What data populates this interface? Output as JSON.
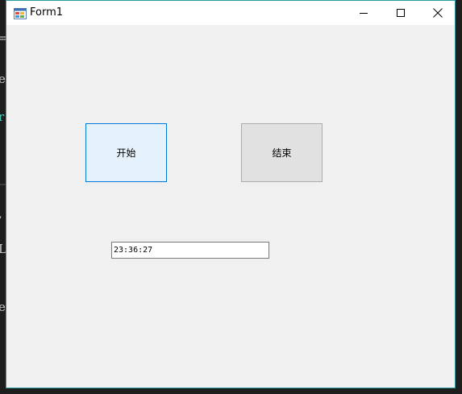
{
  "window": {
    "title": "Form1"
  },
  "buttons": {
    "start_label": "开始",
    "end_label": "结束"
  },
  "time_field": {
    "value": "23:36:27"
  },
  "background_fragments": [
    "=",
    "e",
    "r",
    ",",
    "L",
    "e"
  ],
  "colors": {
    "window_border": "#2b9ba6",
    "start_button_bg": "#e5f1fb",
    "start_button_border": "#0078d7",
    "end_button_bg": "#e1e1e1",
    "end_button_border": "#adadad",
    "form_bg": "#f0f0f0"
  },
  "icons": {
    "app": "winforms-app-icon",
    "minimize": "minimize-icon",
    "maximize": "maximize-icon",
    "close": "close-icon"
  }
}
